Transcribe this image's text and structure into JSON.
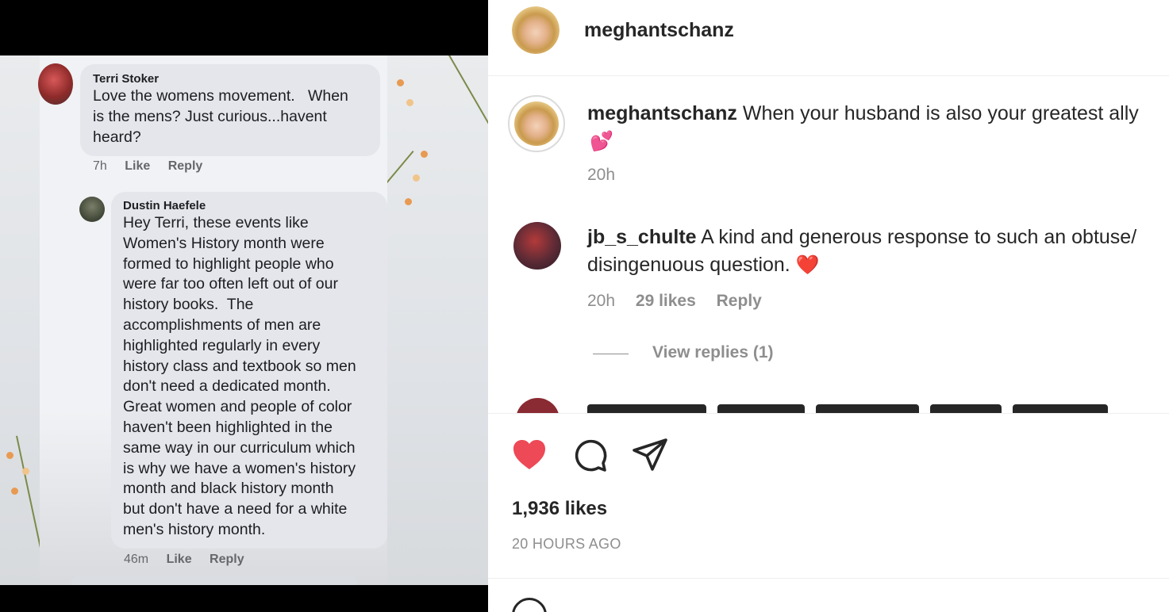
{
  "facebook": {
    "comment": {
      "author": "Terri Stoker",
      "text": "Love the womens movement.   When\nis the mens? Just curious...havent\nheard?",
      "time": "7h",
      "like": "Like",
      "reply": "Reply"
    },
    "reply": {
      "author": "Dustin Haefele",
      "text": "Hey Terri, these events like\nWomen's History month were\nformed to highlight people who\nwere far too often left out of our\nhistory books.  The\naccomplishments of men are\nhighlighted regularly in every\nhistory class and textbook so men\ndon't need a dedicated month.\nGreat women and people of color\nhaven't been highlighted in the\nsame way in our curriculum which\nis why we have a women's history\nmonth and black history month\nbut don't have a need for a white\nmen's history month.",
      "time": "46m",
      "like": "Like",
      "reply": "Reply"
    }
  },
  "instagram": {
    "header": {
      "username": "meghantschanz"
    },
    "caption": {
      "username": "meghantschanz",
      "text": "When your husband is also your greatest ally",
      "emoji": "💕",
      "time": "20h"
    },
    "comments": [
      {
        "username": "jb_s_chulte",
        "text": "A kind and generous response to such an obtuse/ disingenuous question.",
        "emoji": "❤️",
        "time": "20h",
        "likes": "29 likes",
        "reply": "Reply",
        "view_replies": "View replies (1)"
      }
    ],
    "actions": {
      "likes": "1,936 likes",
      "posted": "20 HOURS AGO"
    },
    "colors": {
      "like_red": "#ed4956",
      "text": "#262626",
      "muted": "#8e8e8e"
    },
    "icons": [
      "heart-icon",
      "comment-icon",
      "share-icon",
      "emoji-icon"
    ]
  }
}
